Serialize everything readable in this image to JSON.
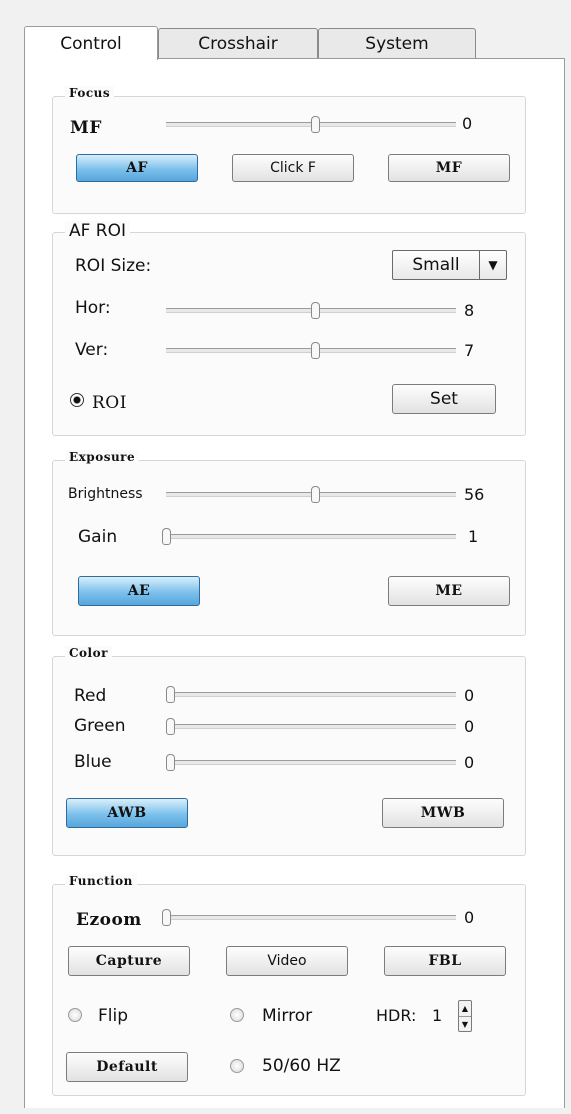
{
  "tabs": [
    {
      "label": "Control",
      "active": true
    },
    {
      "label": "Crosshair",
      "active": false
    },
    {
      "label": "System",
      "active": false
    }
  ],
  "focus": {
    "title": "Focus",
    "mf_label": "MF",
    "mf_value": "0",
    "mf_level": 0.5,
    "buttons": {
      "af": "AF",
      "click_f": "Click F",
      "mf": "MF"
    },
    "active_mode": "AF"
  },
  "af_roi": {
    "title": "AF ROI",
    "roi_size_label": "ROI Size:",
    "roi_size_value": "Small",
    "hor_label": "Hor:",
    "hor_value": "8",
    "ver_label": "Ver:",
    "ver_value": "7",
    "hor_level": 0.5,
    "ver_level": 0.5,
    "roi_radio_label": "ROI",
    "roi_checked": true,
    "set_label": "Set"
  },
  "exposure": {
    "title": "Exposure",
    "brightness_label": "Brightness",
    "brightness_value": "56",
    "brightness_level": 0.5,
    "gain_label": "Gain",
    "gain_value": "1",
    "gain_level": 0.0,
    "buttons": {
      "ae": "AE",
      "me": "ME"
    },
    "active_mode": "AE"
  },
  "color": {
    "title": "Color",
    "red_label": "Red",
    "red_value": "0",
    "green_label": "Green",
    "green_value": "0",
    "blue_label": "Blue",
    "blue_value": "0",
    "buttons": {
      "awb": "AWB",
      "mwb": "MWB"
    },
    "active_mode": "AWB"
  },
  "function": {
    "title": "Function",
    "ezoom_label": "Ezoom",
    "ezoom_value": "0",
    "ezoom_level": 0.0,
    "buttons": {
      "capture": "Capture",
      "video": "Video",
      "fbl": "FBL",
      "default": "Default"
    },
    "flip_label": "Flip",
    "mirror_label": "Mirror",
    "hdr_label": "HDR:",
    "hdr_value": "1",
    "hz_label": "50/60 HZ"
  },
  "colors": {
    "active_button": "#7cc0ec",
    "panel_bg": "#ffffff",
    "window_bg": "#f1f1f1"
  }
}
